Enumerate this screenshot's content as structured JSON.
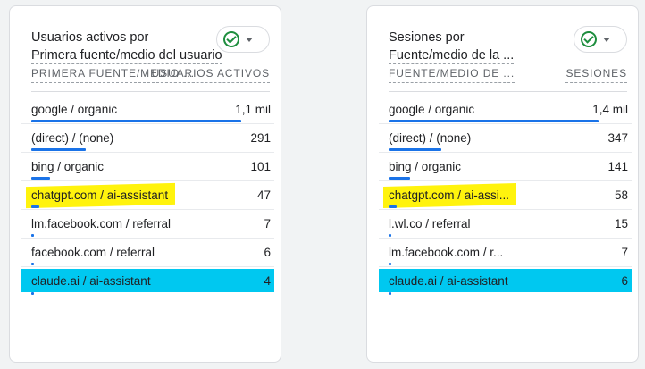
{
  "colors": {
    "accent_bar": "#1a73e8",
    "check_green": "#1e8e3e",
    "highlight_yellow": "#fff200",
    "highlight_cyan": "#00c8f0"
  },
  "cards": [
    {
      "title_line1": "Usuarios activos por",
      "title_line2": "Primera fuente/medio del usuario",
      "status_icon": "check-circle-icon",
      "col_left": "PRIMERA FUENTE/MEDIO ...",
      "col_right": "USUARIOS ACTIVOS",
      "rows": [
        {
          "label": "google / organic",
          "value": "1,1 mil",
          "bar_fraction": 1.0,
          "highlight": "none"
        },
        {
          "label": "(direct) / (none)",
          "value": "291",
          "bar_fraction": 0.26,
          "highlight": "none"
        },
        {
          "label": "bing / organic",
          "value": "101",
          "bar_fraction": 0.09,
          "highlight": "none"
        },
        {
          "label": "chatgpt.com / ai-assistant",
          "value": "47",
          "bar_fraction": 0.04,
          "highlight": "yellow"
        },
        {
          "label": "lm.facebook.com / referral",
          "value": "7",
          "bar_fraction": 0.007,
          "highlight": "none"
        },
        {
          "label": "facebook.com / referral",
          "value": "6",
          "bar_fraction": 0.006,
          "highlight": "none"
        },
        {
          "label": "claude.ai / ai-assistant",
          "value": "4",
          "bar_fraction": 0.004,
          "highlight": "cyan"
        }
      ]
    },
    {
      "title_line1": "Sesiones por",
      "title_line2": "Fuente/medio de la ...",
      "status_icon": "check-circle-icon",
      "col_left": "FUENTE/MEDIO DE ...",
      "col_right": "SESIONES",
      "rows": [
        {
          "label": "google / organic",
          "value": "1,4 mil",
          "bar_fraction": 1.0,
          "highlight": "none"
        },
        {
          "label": "(direct) / (none)",
          "value": "347",
          "bar_fraction": 0.25,
          "highlight": "none"
        },
        {
          "label": "bing / organic",
          "value": "141",
          "bar_fraction": 0.1,
          "highlight": "none"
        },
        {
          "label": "chatgpt.com / ai-assi...",
          "value": "58",
          "bar_fraction": 0.04,
          "highlight": "yellow"
        },
        {
          "label": "l.wl.co / referral",
          "value": "15",
          "bar_fraction": 0.011,
          "highlight": "none"
        },
        {
          "label": "lm.facebook.com / r...",
          "value": "7",
          "bar_fraction": 0.005,
          "highlight": "none"
        },
        {
          "label": "claude.ai / ai-assistant",
          "value": "6",
          "bar_fraction": 0.004,
          "highlight": "cyan"
        }
      ]
    }
  ]
}
